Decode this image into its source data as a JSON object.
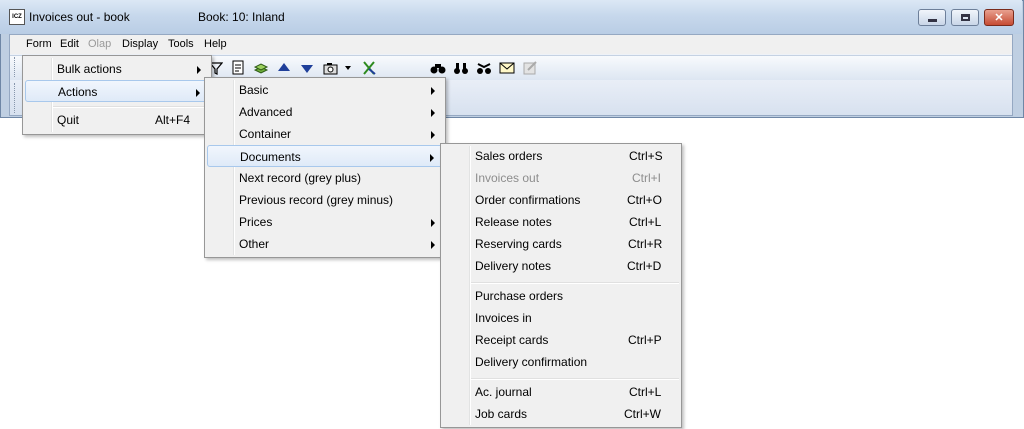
{
  "window": {
    "title": "Invoices out - book",
    "book": "Book: 10: Inland",
    "icon_text": "ICZ"
  },
  "menubar": [
    "Form",
    "Edit",
    "Olap",
    "Display",
    "Tools",
    "Help"
  ],
  "form_menu": [
    {
      "label": "Bulk actions",
      "submenu": true
    },
    {
      "label": "Actions",
      "submenu": true
    },
    {
      "label": "Quit",
      "shortcut": "Alt+F4"
    }
  ],
  "actions_menu": [
    {
      "label": "Basic",
      "submenu": true
    },
    {
      "label": "Advanced",
      "submenu": true
    },
    {
      "label": "Container",
      "submenu": true
    },
    {
      "label": "Documents",
      "submenu": true
    },
    {
      "label": "Next record (grey plus)"
    },
    {
      "label": "Previous record (grey minus)"
    },
    {
      "label": "Prices",
      "submenu": true
    },
    {
      "label": "Other",
      "submenu": true
    }
  ],
  "documents_menu": [
    {
      "label": "Sales orders",
      "shortcut": "Ctrl+S"
    },
    {
      "label": "Invoices out",
      "shortcut": "Ctrl+I",
      "disabled": true
    },
    {
      "label": "Order confirmations",
      "shortcut": "Ctrl+O"
    },
    {
      "label": "Release notes",
      "shortcut": "Ctrl+L"
    },
    {
      "label": "Reserving cards",
      "shortcut": "Ctrl+R"
    },
    {
      "label": "Delivery notes",
      "shortcut": "Ctrl+D"
    },
    {
      "label": "Purchase orders",
      "shortcut": ""
    },
    {
      "label": "Invoices in",
      "shortcut": ""
    },
    {
      "label": "Receipt cards",
      "shortcut": "Ctrl+P"
    },
    {
      "label": "Delivery confirmation",
      "shortcut": ""
    },
    {
      "label": "Ac. journal",
      "shortcut": "Ctrl+L"
    },
    {
      "label": "Job cards",
      "shortcut": "Ctrl+W"
    }
  ]
}
